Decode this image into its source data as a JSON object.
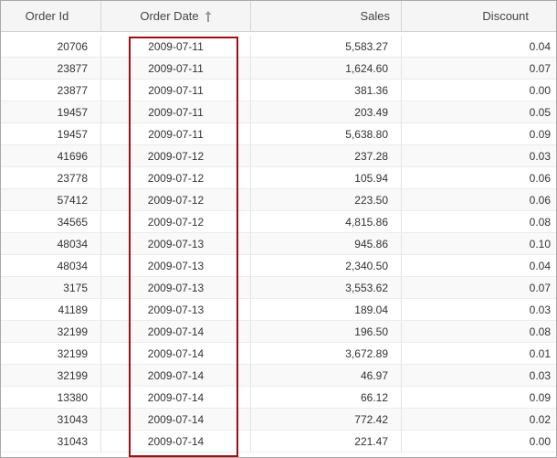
{
  "columns": {
    "order_id": "Order Id",
    "order_date": "Order Date",
    "sales": "Sales",
    "discount": "Discount"
  },
  "sort": {
    "column": "order_date",
    "direction": "ascending",
    "icon": "sort-ascending-arrow-icon"
  },
  "highlight_color": "#a10d10",
  "rows": [
    {
      "order_id": "20706",
      "order_date": "2009-07-11",
      "sales": "5,583.27",
      "discount": "0.04"
    },
    {
      "order_id": "23877",
      "order_date": "2009-07-11",
      "sales": "1,624.60",
      "discount": "0.07"
    },
    {
      "order_id": "23877",
      "order_date": "2009-07-11",
      "sales": "381.36",
      "discount": "0.00"
    },
    {
      "order_id": "19457",
      "order_date": "2009-07-11",
      "sales": "203.49",
      "discount": "0.05"
    },
    {
      "order_id": "19457",
      "order_date": "2009-07-11",
      "sales": "5,638.80",
      "discount": "0.09"
    },
    {
      "order_id": "41696",
      "order_date": "2009-07-12",
      "sales": "237.28",
      "discount": "0.03"
    },
    {
      "order_id": "23778",
      "order_date": "2009-07-12",
      "sales": "105.94",
      "discount": "0.06"
    },
    {
      "order_id": "57412",
      "order_date": "2009-07-12",
      "sales": "223.50",
      "discount": "0.06"
    },
    {
      "order_id": "34565",
      "order_date": "2009-07-12",
      "sales": "4,815.86",
      "discount": "0.08"
    },
    {
      "order_id": "48034",
      "order_date": "2009-07-13",
      "sales": "945.86",
      "discount": "0.10"
    },
    {
      "order_id": "48034",
      "order_date": "2009-07-13",
      "sales": "2,340.50",
      "discount": "0.04"
    },
    {
      "order_id": "3175",
      "order_date": "2009-07-13",
      "sales": "3,553.62",
      "discount": "0.07"
    },
    {
      "order_id": "41189",
      "order_date": "2009-07-13",
      "sales": "189.04",
      "discount": "0.03"
    },
    {
      "order_id": "32199",
      "order_date": "2009-07-14",
      "sales": "196.50",
      "discount": "0.08"
    },
    {
      "order_id": "32199",
      "order_date": "2009-07-14",
      "sales": "3,672.89",
      "discount": "0.01"
    },
    {
      "order_id": "32199",
      "order_date": "2009-07-14",
      "sales": "46.97",
      "discount": "0.03"
    },
    {
      "order_id": "13380",
      "order_date": "2009-07-14",
      "sales": "66.12",
      "discount": "0.09"
    },
    {
      "order_id": "31043",
      "order_date": "2009-07-14",
      "sales": "772.42",
      "discount": "0.02"
    },
    {
      "order_id": "31043",
      "order_date": "2009-07-14",
      "sales": "221.47",
      "discount": "0.00"
    }
  ]
}
